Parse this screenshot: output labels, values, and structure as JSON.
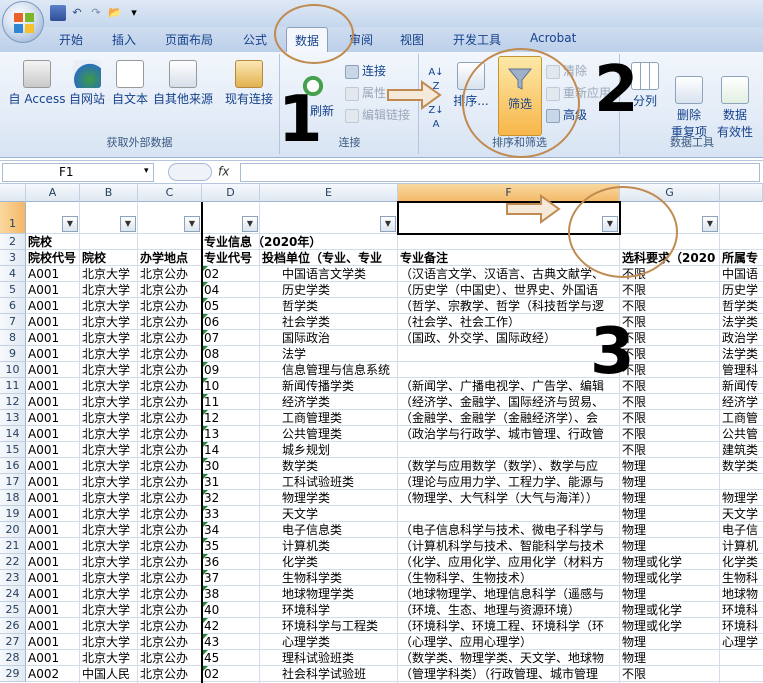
{
  "qat": {
    "undo": "↶",
    "redo": "↷",
    "open": "📂",
    "more": "▾"
  },
  "tabs": [
    "开始",
    "插入",
    "页面布局",
    "公式",
    "数据",
    "审阅",
    "视图",
    "开发工具",
    "Acrobat"
  ],
  "ribbon": {
    "external": {
      "access": "自 Access",
      "web": "自网站",
      "text": "自文本",
      "other": "自其他来源",
      "existing": "现有连接",
      "label": "获取外部数据"
    },
    "connections": {
      "refresh": "刷新",
      "connect": "连接",
      "props": "属性",
      "edit": "编辑链接",
      "label": "连接"
    },
    "sort_filter": {
      "sort": "排序...",
      "filter": "筛选",
      "clear": "清除",
      "reapply": "重新应用",
      "advanced": "高级",
      "label": "排序和筛选"
    },
    "tools": {
      "split": "分列",
      "remove_dup": "删除\n重复项",
      "validation": "数据\n有效性",
      "label": "数据工具"
    }
  },
  "formula": {
    "name": "F1",
    "fx": "fx",
    "value": ""
  },
  "colors": {
    "selected": "#f5c06f",
    "annot": "#c08a50",
    "grid": "#d4dceb"
  },
  "columns": [
    "A",
    "B",
    "C",
    "D",
    "E",
    "F",
    "G"
  ],
  "header": {
    "r2": [
      "院校",
      "",
      "",
      "专业信息（2020年）",
      "",
      "",
      "",
      ""
    ],
    "r3": [
      "院校代号",
      "院校",
      "办学地点",
      "专业代号",
      "投档单位（专业、专业",
      "专业备注",
      "选科要求（2020",
      "所属专"
    ]
  },
  "rows": [
    {
      "n": "4",
      "a": "A001",
      "b": "北京大学",
      "c": "北京公办",
      "d": "02",
      "e": "中国语言文学类",
      "f": "（汉语言文学、汉语言、古典文献学、",
      "g": "不限",
      "h": "中国语"
    },
    {
      "n": "5",
      "a": "A001",
      "b": "北京大学",
      "c": "北京公办",
      "d": "04",
      "e": "历史学类",
      "f": "（历史学（中国史）、世界史、外国语",
      "g": "不限",
      "h": "历史学"
    },
    {
      "n": "6",
      "a": "A001",
      "b": "北京大学",
      "c": "北京公办",
      "d": "05",
      "e": "哲学类",
      "f": "（哲学、宗教学、哲学（科技哲学与逻",
      "g": "不限",
      "h": "哲学类"
    },
    {
      "n": "7",
      "a": "A001",
      "b": "北京大学",
      "c": "北京公办",
      "d": "06",
      "e": "社会学类",
      "f": "（社会学、社会工作）",
      "g": "不限",
      "h": "法学类"
    },
    {
      "n": "8",
      "a": "A001",
      "b": "北京大学",
      "c": "北京公办",
      "d": "07",
      "e": "国际政治",
      "f": "（国政、外交学、国际政经）",
      "g": "不限",
      "h": "政治学"
    },
    {
      "n": "9",
      "a": "A001",
      "b": "北京大学",
      "c": "北京公办",
      "d": "08",
      "e": "法学",
      "f": "",
      "g": "不限",
      "h": "法学类"
    },
    {
      "n": "10",
      "a": "A001",
      "b": "北京大学",
      "c": "北京公办",
      "d": "09",
      "e": "信息管理与信息系统",
      "f": "",
      "g": "不限",
      "h": "管理科"
    },
    {
      "n": "11",
      "a": "A001",
      "b": "北京大学",
      "c": "北京公办",
      "d": "10",
      "e": "新闻传播学类",
      "f": "（新闻学、广播电视学、广告学、编辑",
      "g": "不限",
      "h": "新闻传"
    },
    {
      "n": "12",
      "a": "A001",
      "b": "北京大学",
      "c": "北京公办",
      "d": "11",
      "e": "经济学类",
      "f": "（经济学、金融学、国际经济与贸易、",
      "g": "不限",
      "h": "经济学"
    },
    {
      "n": "13",
      "a": "A001",
      "b": "北京大学",
      "c": "北京公办",
      "d": "12",
      "e": "工商管理类",
      "f": "（金融学、金融学（金融经济学）、会",
      "g": "不限",
      "h": "工商管"
    },
    {
      "n": "14",
      "a": "A001",
      "b": "北京大学",
      "c": "北京公办",
      "d": "13",
      "e": "公共管理类",
      "f": "（政治学与行政学、城市管理、行政管",
      "g": "不限",
      "h": "公共管"
    },
    {
      "n": "15",
      "a": "A001",
      "b": "北京大学",
      "c": "北京公办",
      "d": "14",
      "e": "城乡规划",
      "f": "",
      "g": "不限",
      "h": "建筑类"
    },
    {
      "n": "16",
      "a": "A001",
      "b": "北京大学",
      "c": "北京公办",
      "d": "30",
      "e": "数学类",
      "f": "（数学与应用数学（数学）、数学与应",
      "g": "物理",
      "h": "数学类"
    },
    {
      "n": "17",
      "a": "A001",
      "b": "北京大学",
      "c": "北京公办",
      "d": "31",
      "e": "工科试验班类",
      "f": "（理论与应用力学、工程力学、能源与",
      "g": "物理",
      "h": ""
    },
    {
      "n": "18",
      "a": "A001",
      "b": "北京大学",
      "c": "北京公办",
      "d": "32",
      "e": "物理学类",
      "f": "（物理学、大气科学（大气与海洋））",
      "g": "物理",
      "h": "物理学"
    },
    {
      "n": "19",
      "a": "A001",
      "b": "北京大学",
      "c": "北京公办",
      "d": "33",
      "e": "天文学",
      "f": "",
      "g": "物理",
      "h": "天文学"
    },
    {
      "n": "20",
      "a": "A001",
      "b": "北京大学",
      "c": "北京公办",
      "d": "34",
      "e": "电子信息类",
      "f": "（电子信息科学与技术、微电子科学与",
      "g": "物理",
      "h": "电子信"
    },
    {
      "n": "21",
      "a": "A001",
      "b": "北京大学",
      "c": "北京公办",
      "d": "35",
      "e": "计算机类",
      "f": "（计算机科学与技术、智能科学与技术",
      "g": "物理",
      "h": "计算机"
    },
    {
      "n": "22",
      "a": "A001",
      "b": "北京大学",
      "c": "北京公办",
      "d": "36",
      "e": "化学类",
      "f": "（化学、应用化学、应用化学（材料方",
      "g": "物理或化学",
      "h": "化学类"
    },
    {
      "n": "23",
      "a": "A001",
      "b": "北京大学",
      "c": "北京公办",
      "d": "37",
      "e": "生物科学类",
      "f": "（生物科学、生物技术）",
      "g": "物理或化学",
      "h": "生物科"
    },
    {
      "n": "24",
      "a": "A001",
      "b": "北京大学",
      "c": "北京公办",
      "d": "38",
      "e": "地球物理学类",
      "f": "（地球物理学、地理信息科学（遥感与",
      "g": "物理",
      "h": "地球物"
    },
    {
      "n": "25",
      "a": "A001",
      "b": "北京大学",
      "c": "北京公办",
      "d": "40",
      "e": "环境科学",
      "f": "（环境、生态、地理与资源环境）",
      "g": "物理或化学",
      "h": "环境科"
    },
    {
      "n": "26",
      "a": "A001",
      "b": "北京大学",
      "c": "北京公办",
      "d": "42",
      "e": "环境科学与工程类",
      "f": "（环境科学、环境工程、环境科学（环",
      "g": "物理或化学",
      "h": "环境科"
    },
    {
      "n": "27",
      "a": "A001",
      "b": "北京大学",
      "c": "北京公办",
      "d": "43",
      "e": "心理学类",
      "f": "（心理学、应用心理学）",
      "g": "物理",
      "h": "心理学"
    },
    {
      "n": "28",
      "a": "A001",
      "b": "北京大学",
      "c": "北京公办",
      "d": "45",
      "e": "理科试验班类",
      "f": "（数学类、物理学类、天文学、地球物",
      "g": "物理",
      "h": ""
    },
    {
      "n": "29",
      "a": "A002",
      "b": "中国人民",
      "c": "北京公办",
      "d": "02",
      "e": "社会科学试验班",
      "f": "（管理学科类）（行政管理、城市管理",
      "g": "不限",
      "h": ""
    }
  ],
  "annotations": {
    "one": "1",
    "two": "2",
    "three": "3"
  }
}
